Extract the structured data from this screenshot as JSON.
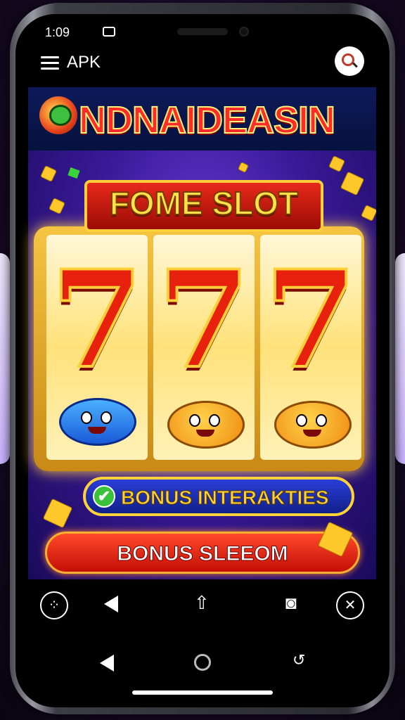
{
  "status_bar": {
    "time": "1:09"
  },
  "header": {
    "menu_label": "APK"
  },
  "brand": {
    "title": "NDNAIDEASIN"
  },
  "slot": {
    "ribbon_title": "FOME SLOT",
    "reels": [
      "7",
      "7",
      "7"
    ]
  },
  "buttons": {
    "bonus_interactions": "BONUS INTERAKTIES",
    "bonus_sleeom": "BONUS SLEEOM"
  },
  "bottom_nav": {
    "icons": [
      "apps-icon",
      "back-icon",
      "share-icon",
      "camera-icon",
      "close-icon"
    ]
  },
  "colors": {
    "accent": "#ffd23a",
    "primary_button": "#e8291a",
    "secondary_button": "#2a3ed8"
  }
}
